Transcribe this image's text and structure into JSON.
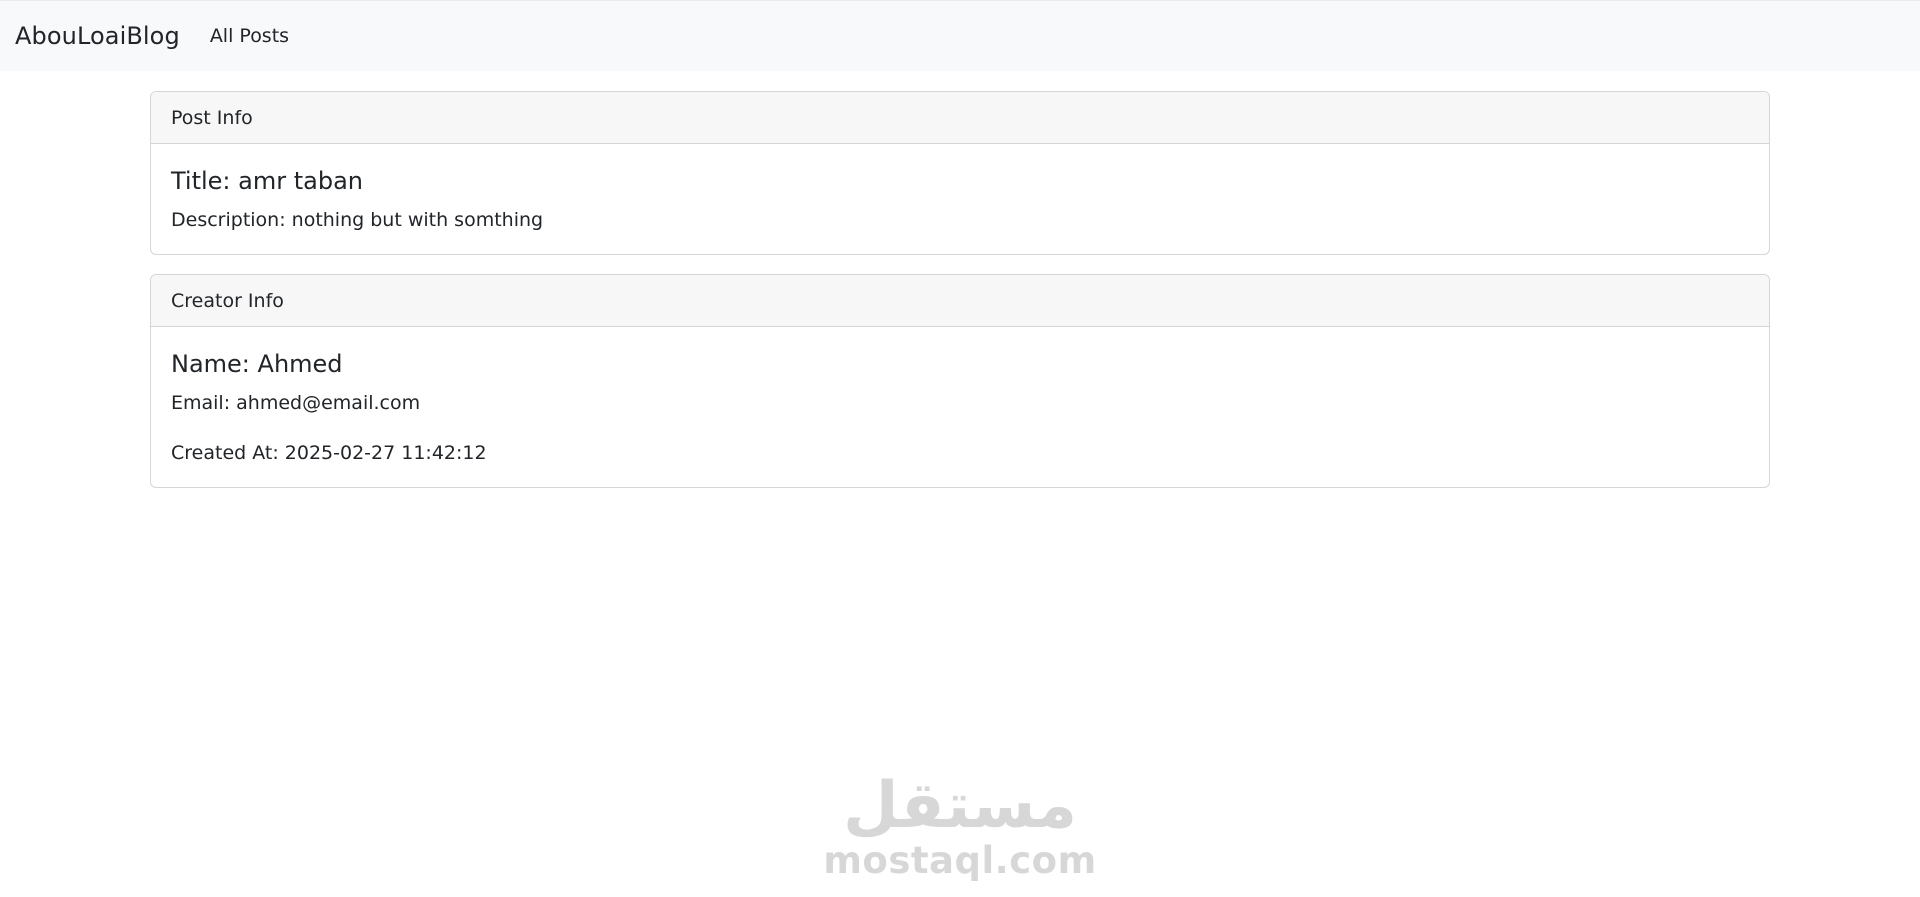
{
  "navbar": {
    "brand": "AbouLoaiBlog",
    "links": [
      {
        "label": "All Posts"
      }
    ]
  },
  "post_card": {
    "header": "Post Info",
    "title": "Title: amr taban",
    "description": "Description: nothing but with somthing"
  },
  "creator_card": {
    "header": "Creator Info",
    "name": "Name: Ahmed",
    "email": "Email: ahmed@email.com",
    "created_at": "Created At: 2025-02-27 11:42:12"
  },
  "watermark": {
    "arabic": "مستقل",
    "latin": "mostaql.com"
  },
  "colors": {
    "navbar_bg": "#f8f9fa",
    "card_header_bg": "#f7f7f7",
    "card_border": "#d3d6da",
    "text": "#212529"
  }
}
